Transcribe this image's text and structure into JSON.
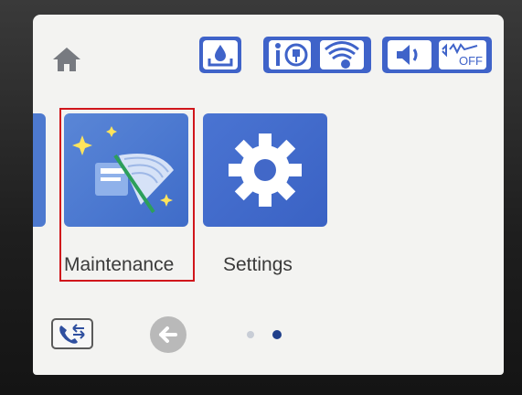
{
  "tiles": [
    {
      "label": "Maintenance",
      "selected": true
    },
    {
      "label": "Settings",
      "selected": false
    }
  ],
  "status_icons": [
    "home-icon",
    "ink-drop-icon",
    "wifi-direct-icon",
    "wifi-icon",
    "speaker-icon",
    "quiet-mode-icon"
  ],
  "quiet_mode_label": "OFF",
  "pagination": {
    "pages": 2,
    "current": 2
  },
  "colors": {
    "accent": "#3f63c9",
    "highlight": "#d0161b",
    "background": "#f3f3f1"
  }
}
